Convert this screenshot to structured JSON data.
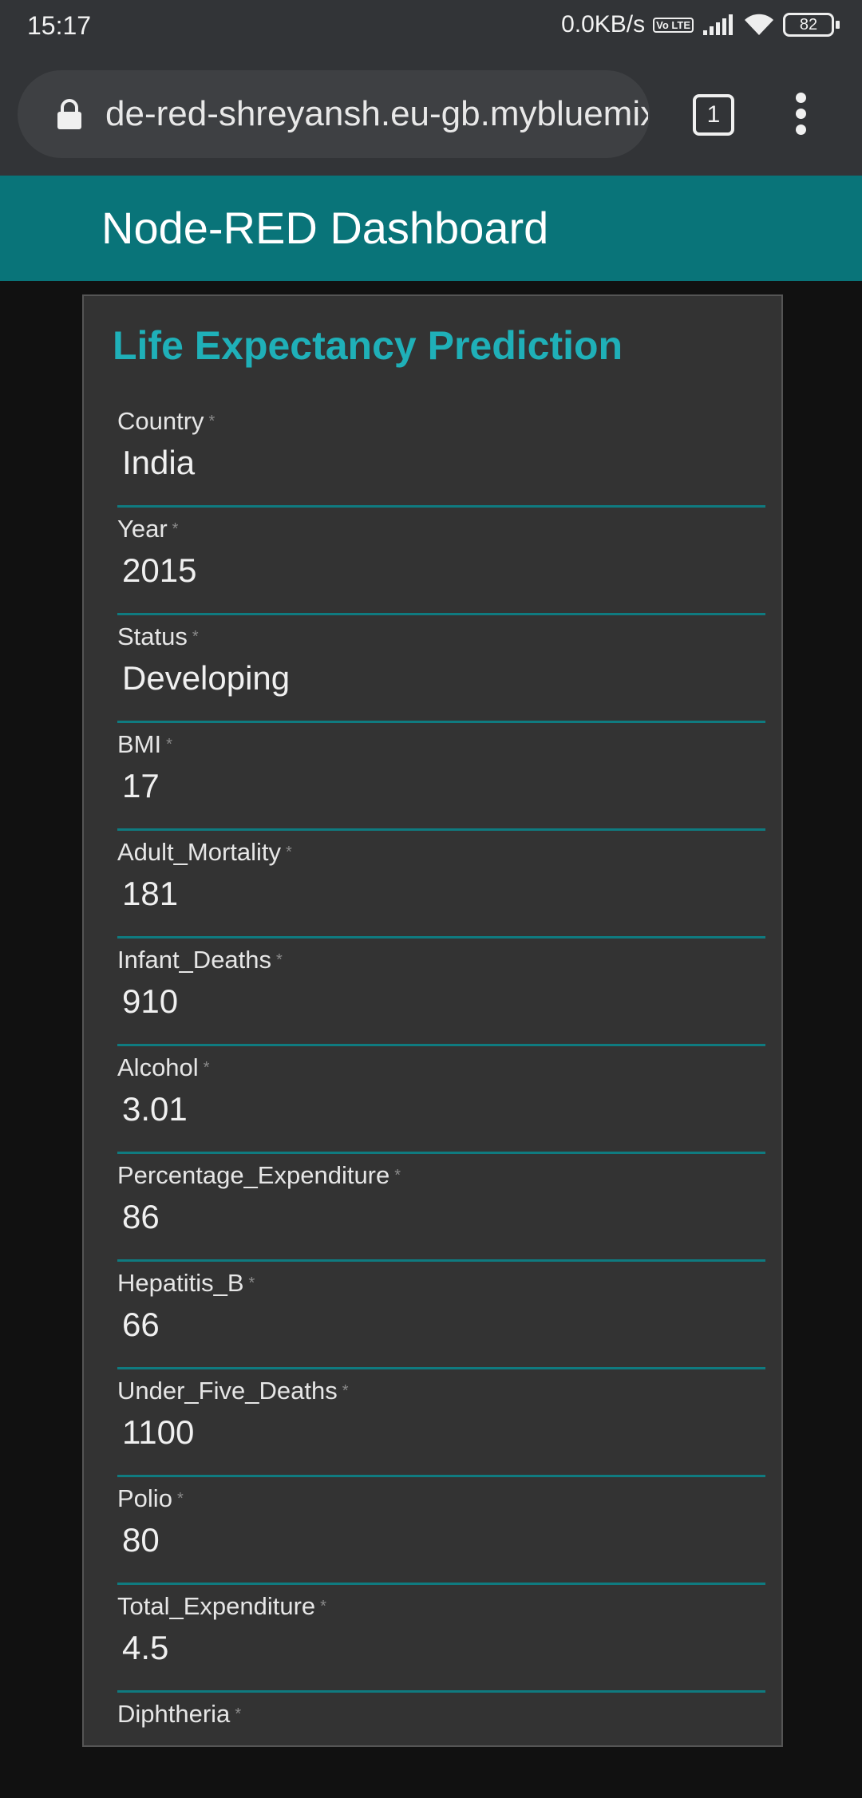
{
  "status_bar": {
    "time": "15:17",
    "network_speed": "0.0KB/s",
    "volte": "Vo LTE",
    "battery": "82"
  },
  "browser": {
    "url": "de-red-shreyansh.eu-gb.mybluemix",
    "tab_count": "1"
  },
  "app": {
    "title": "Node-RED Dashboard"
  },
  "form": {
    "title": "Life Expectancy Prediction",
    "required_marker": "*",
    "fields": [
      {
        "label": "Country",
        "value": "India"
      },
      {
        "label": "Year",
        "value": "2015"
      },
      {
        "label": "Status",
        "value": "Developing"
      },
      {
        "label": "BMI",
        "value": "17"
      },
      {
        "label": "Adult_Mortality",
        "value": "181"
      },
      {
        "label": "Infant_Deaths",
        "value": "910"
      },
      {
        "label": "Alcohol",
        "value": "3.01"
      },
      {
        "label": "Percentage_Expenditure",
        "value": "86"
      },
      {
        "label": "Hepatitis_B",
        "value": "66"
      },
      {
        "label": "Under_Five_Deaths",
        "value": "1100"
      },
      {
        "label": "Polio",
        "value": "80"
      },
      {
        "label": "Total_Expenditure",
        "value": "4.5"
      },
      {
        "label": "Diphtheria",
        "value": ""
      }
    ]
  }
}
